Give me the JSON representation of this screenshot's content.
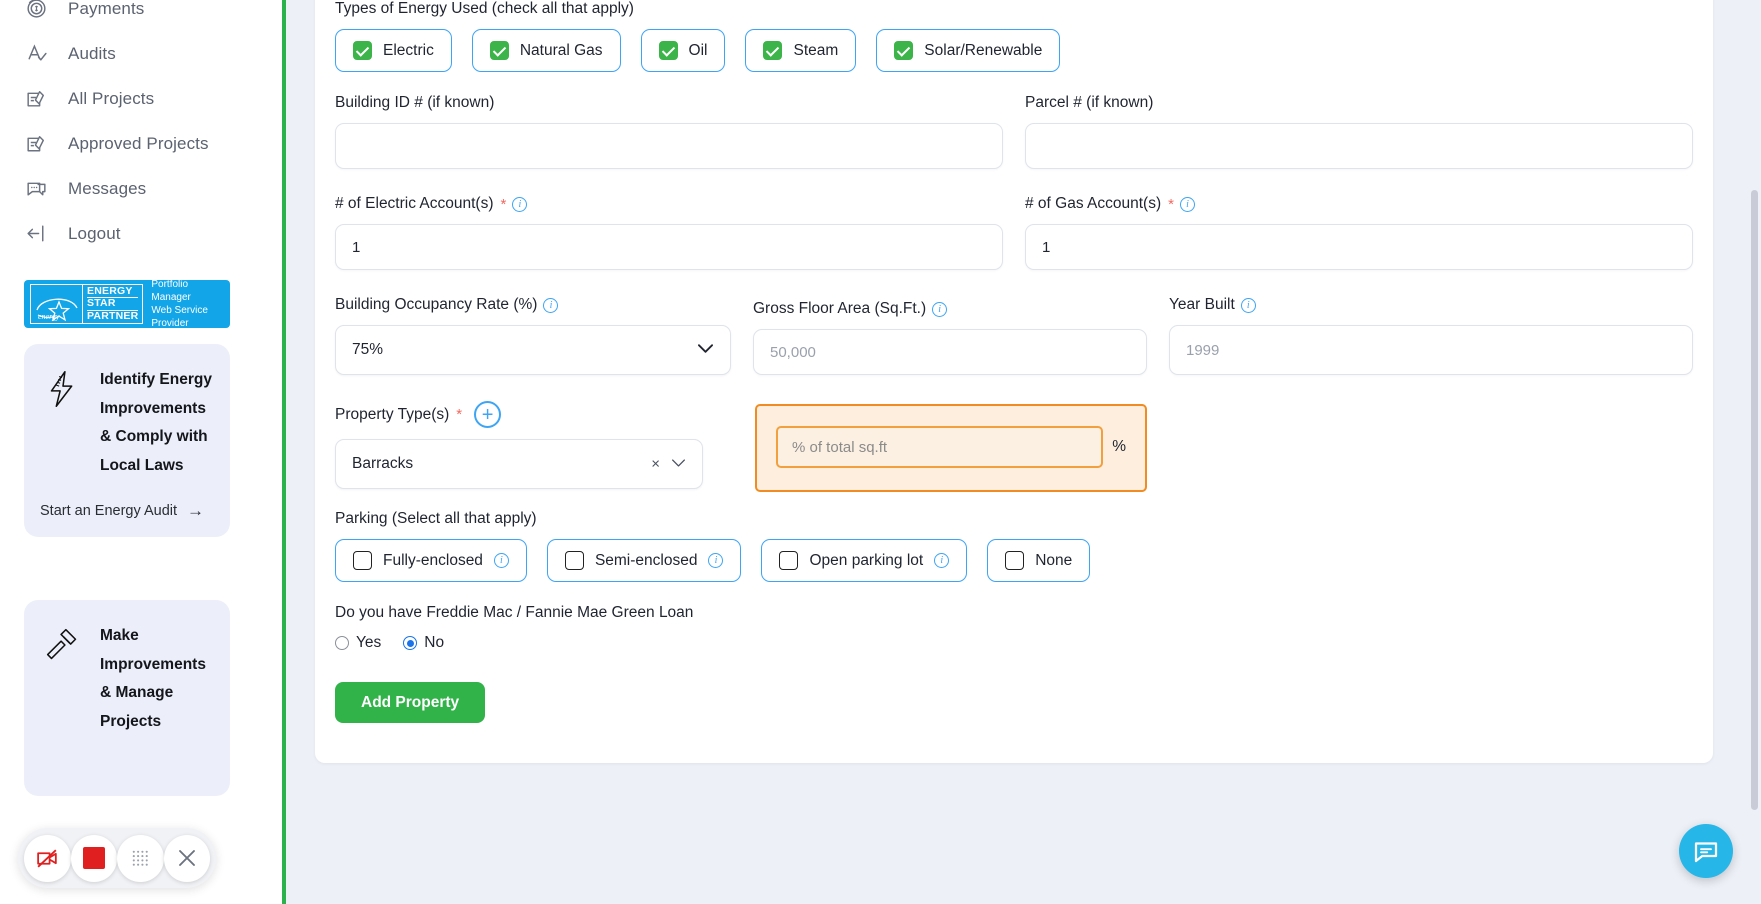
{
  "sidebar": {
    "nav_items": [
      {
        "label": "Payments",
        "icon": "payments-icon"
      },
      {
        "label": "Audits",
        "icon": "audits-icon"
      },
      {
        "label": "All Projects",
        "icon": "all-projects-icon"
      },
      {
        "label": "Approved Projects",
        "icon": "approved-projects-icon"
      },
      {
        "label": "Messages",
        "icon": "messages-icon"
      },
      {
        "label": "Logout",
        "icon": "logout-icon"
      }
    ],
    "badge": {
      "line1": "ENERGY",
      "line2": "STAR",
      "line3": "PARTNER",
      "sub1": "Portfolio Manager",
      "sub2": "Web Service Provider",
      "color": "#12a5e8"
    },
    "promos": [
      {
        "icon": "lightning-bolt-icon",
        "title": "Identify Energy Improvements & Comply with Local Laws",
        "link": "Start an Energy Audit",
        "arrow": "→"
      },
      {
        "icon": "gavel-icon",
        "title": "Make Improvements & Manage Projects"
      }
    ]
  },
  "form": {
    "energy_types": {
      "label": "Types of Energy Used (check all that apply)",
      "options": [
        {
          "label": "Electric",
          "checked": true
        },
        {
          "label": "Natural Gas",
          "checked": true
        },
        {
          "label": "Oil",
          "checked": true
        },
        {
          "label": "Steam",
          "checked": true
        },
        {
          "label": "Solar/Renewable",
          "checked": true
        }
      ]
    },
    "building_id": {
      "label": "Building ID # (if known)",
      "value": "",
      "placeholder": ""
    },
    "parcel": {
      "label": "Parcel # (if known)",
      "value": "",
      "placeholder": ""
    },
    "electric_accounts": {
      "label": "# of Electric Account(s)",
      "required": "*",
      "value": "1"
    },
    "gas_accounts": {
      "label": "# of Gas Account(s)",
      "required": "*",
      "value": "1"
    },
    "occupancy_rate": {
      "label": "Building Occupancy Rate (%)",
      "value": "75%"
    },
    "gross_floor_area": {
      "label": "Gross Floor Area (Sq.Ft.)",
      "placeholder": "50,000"
    },
    "year_built": {
      "label": "Year Built",
      "placeholder": "1999"
    },
    "property_types": {
      "label": "Property Type(s)",
      "required": "*",
      "add_label": "+",
      "selected": "Barracks",
      "clear": "×",
      "pct_placeholder": "% of total sq.ft",
      "pct_value": "",
      "pct_sign": "%"
    },
    "parking": {
      "label": "Parking (Select all that apply)",
      "options": [
        {
          "label": "Fully-enclosed",
          "checked": false,
          "has_info": true
        },
        {
          "label": "Semi-enclosed",
          "checked": false,
          "has_info": true
        },
        {
          "label": "Open parking lot",
          "checked": false,
          "has_info": true
        },
        {
          "label": "None",
          "checked": false,
          "has_info": false
        }
      ]
    },
    "green_loan": {
      "label": "Do you have Freddie Mac / Fannie Mae Green Loan",
      "options": [
        {
          "label": "Yes",
          "selected": false
        },
        {
          "label": "No",
          "selected": true
        }
      ]
    },
    "submit_label": "Add Property"
  },
  "overlay": {
    "rec_buttons": [
      {
        "name": "camera-off-icon"
      },
      {
        "name": "stop-recording-icon"
      },
      {
        "name": "grid-dots-icon"
      },
      {
        "name": "close-icon"
      }
    ],
    "chat": {
      "icon": "chat-bubble-icon",
      "color": "#26b6e8"
    }
  }
}
